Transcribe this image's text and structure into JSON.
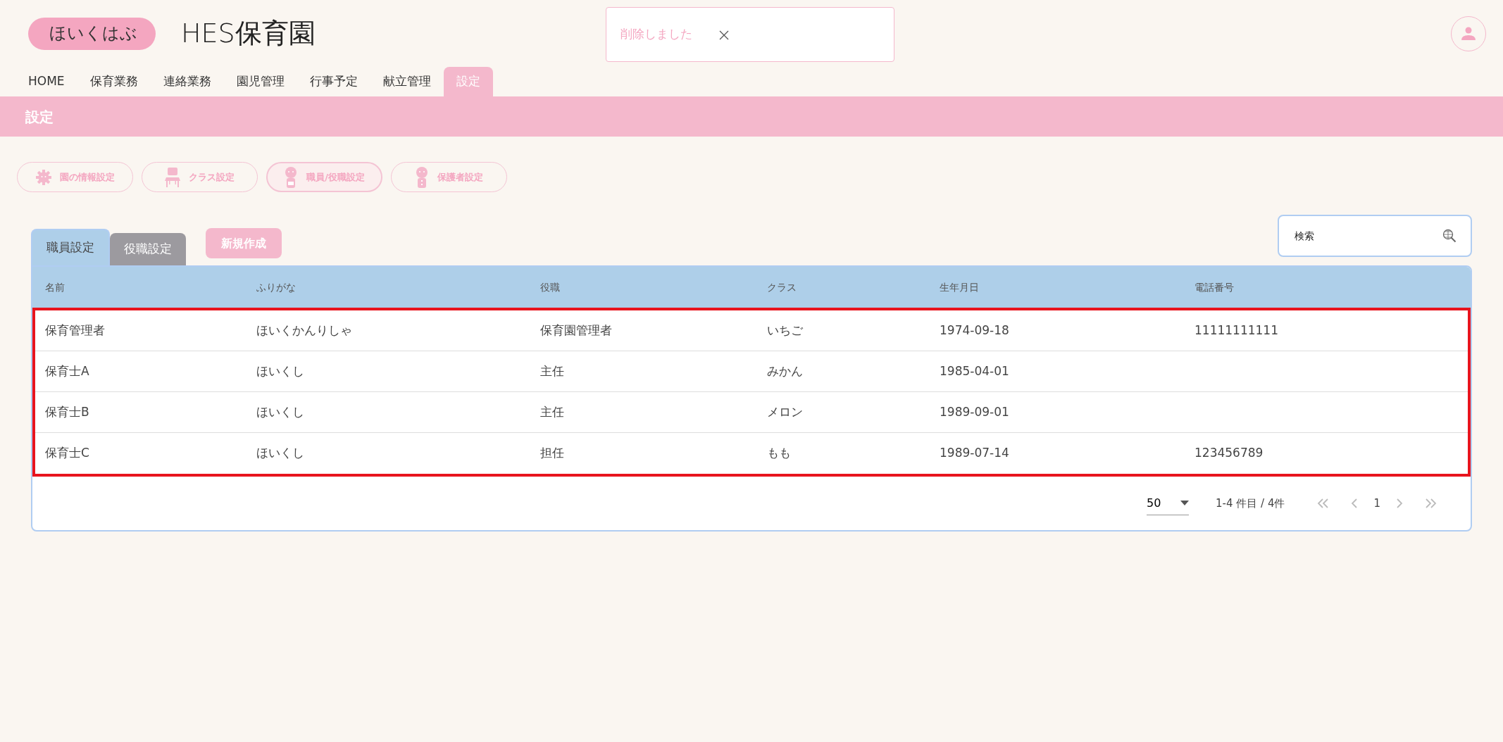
{
  "logo": {
    "text": "ほいくはぶ"
  },
  "title": "HES保育園",
  "toast": {
    "message": "削除しました"
  },
  "nav": [
    {
      "label": "HOME",
      "selected": false
    },
    {
      "label": "保育業務",
      "selected": false
    },
    {
      "label": "連絡業務",
      "selected": false
    },
    {
      "label": "園児管理",
      "selected": false
    },
    {
      "label": "行事予定",
      "selected": false
    },
    {
      "label": "献立管理",
      "selected": false
    },
    {
      "label": "設定",
      "selected": true
    }
  ],
  "page_title": "設定",
  "settings_buttons": [
    {
      "label": "園の情報設定",
      "kind": "gear",
      "selected": false
    },
    {
      "label": "クラス設定",
      "kind": "chair",
      "selected": false
    },
    {
      "label": "職員/役職設定",
      "kind": "staff",
      "selected": true
    },
    {
      "label": "保護者設定",
      "kind": "guardian",
      "selected": false
    }
  ],
  "subtabs": [
    {
      "label": "職員設定",
      "selected": true
    },
    {
      "label": "役職設定",
      "selected": false
    }
  ],
  "new_button": "新規作成",
  "search": {
    "placeholder": "検索"
  },
  "table": {
    "columns": [
      "名前",
      "ふりがな",
      "役職",
      "クラス",
      "生年月日",
      "電話番号"
    ],
    "rows": [
      [
        "保育管理者",
        "ほいくかんりしゃ",
        "保育園管理者",
        "いちご",
        "1974-09-18",
        "11111111111"
      ],
      [
        "保育士A",
        "ほいくし",
        "主任",
        "みかん",
        "1985-04-01",
        ""
      ],
      [
        "保育士B",
        "ほいくし",
        "主任",
        "メロン",
        "1989-09-01",
        ""
      ],
      [
        "保育士C",
        "ほいくし",
        "担任",
        "もも",
        "1989-07-14",
        "123456789"
      ]
    ]
  },
  "pagination": {
    "page_size": "50",
    "range": "1-4 件目 / 4件",
    "current_page": "1"
  }
}
